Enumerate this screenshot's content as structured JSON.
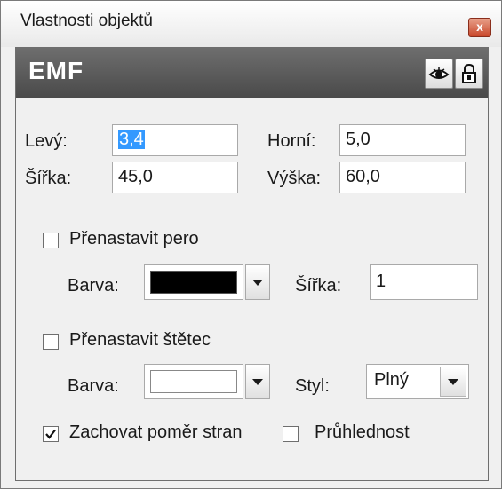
{
  "window": {
    "title": "Vlastnosti objektů",
    "close_glyph": "x"
  },
  "header": {
    "title": "EMF",
    "visibility_icon": "eye-icon",
    "lock_icon": "lock-icon"
  },
  "position": {
    "left_label": "Levý:",
    "left_value": "3,4",
    "top_label": "Horní:",
    "top_value": "5,0",
    "width_label": "Šířka:",
    "width_value": "45,0",
    "height_label": "Výška:",
    "height_value": "60,0"
  },
  "pen": {
    "override_label": "Přenastavit pero",
    "override_checked": false,
    "color_label": "Barva:",
    "color": "#000000",
    "width_label": "Šířka:",
    "width_value": "1"
  },
  "brush": {
    "override_label": "Přenastavit štětec",
    "override_checked": false,
    "color_label": "Barva:",
    "color": "#ffffff",
    "style_label": "Styl:",
    "style_value": "Plný"
  },
  "options": {
    "keep_ratio_label": "Zachovat poměr stran",
    "keep_ratio_checked": true,
    "transparency_label": "Průhlednost",
    "transparency_checked": false
  }
}
